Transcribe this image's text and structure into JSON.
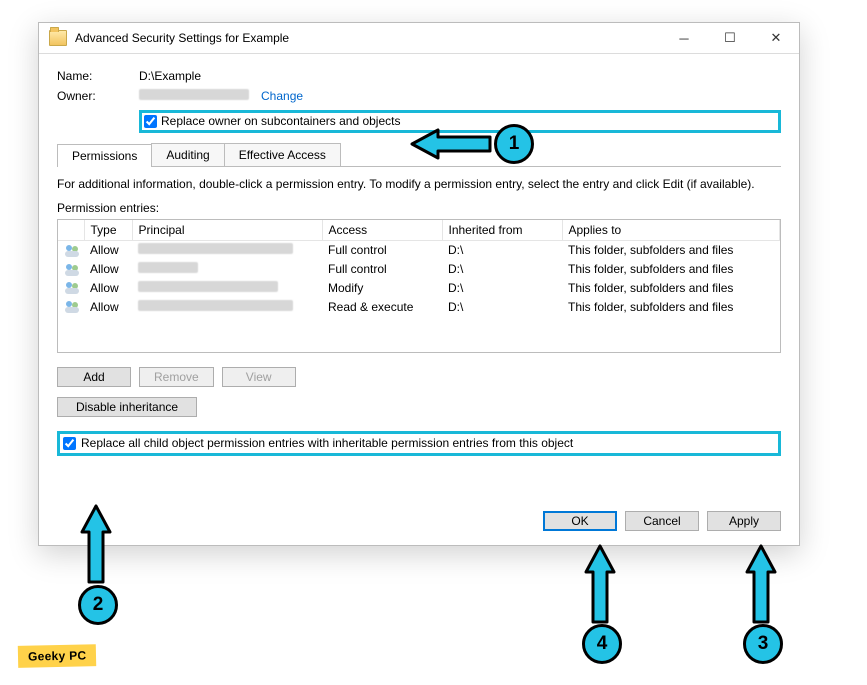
{
  "window": {
    "title": "Advanced Security Settings for Example"
  },
  "header": {
    "name_label": "Name:",
    "name_value": "D:\\Example",
    "owner_label": "Owner:",
    "change_link": "Change",
    "replace_owner_cb": "Replace owner on subcontainers and objects"
  },
  "tabs": {
    "permissions": "Permissions",
    "auditing": "Auditing",
    "effective": "Effective Access"
  },
  "info_line": "For additional information, double-click a permission entry. To modify a permission entry, select the entry and click Edit (if available).",
  "perm_header": "Permission entries:",
  "cols": {
    "blank": "",
    "type": "Type",
    "principal": "Principal",
    "access": "Access",
    "inherited": "Inherited from",
    "applies": "Applies to"
  },
  "rows": [
    {
      "type": "Allow",
      "access": "Full control",
      "inherited": "D:\\",
      "applies": "This folder, subfolders and files"
    },
    {
      "type": "Allow",
      "access": "Full control",
      "inherited": "D:\\",
      "applies": "This folder, subfolders and files"
    },
    {
      "type": "Allow",
      "access": "Modify",
      "inherited": "D:\\",
      "applies": "This folder, subfolders and files"
    },
    {
      "type": "Allow",
      "access": "Read & execute",
      "inherited": "D:\\",
      "applies": "This folder, subfolders and files"
    }
  ],
  "buttons": {
    "add": "Add",
    "remove": "Remove",
    "view": "View",
    "disable_inh": "Disable inheritance",
    "replace_child_cb": "Replace all child object permission entries with inheritable permission entries from this object",
    "ok": "OK",
    "cancel": "Cancel",
    "apply": "Apply"
  },
  "annotations": {
    "b1": "1",
    "b2": "2",
    "b3": "3",
    "b4": "4"
  },
  "watermark": "Geeky PC"
}
